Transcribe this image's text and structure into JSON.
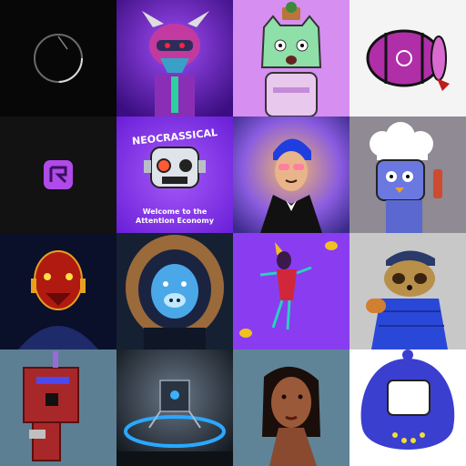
{
  "gallery": {
    "tiles": [
      {
        "name": "tile-ring",
        "icon": "ring-icon"
      },
      {
        "name": "tile-horned-monster",
        "icon": "monster-icon"
      },
      {
        "name": "tile-cat-plant",
        "icon": "cat-icon"
      },
      {
        "name": "tile-barrel",
        "icon": "barrel-icon"
      },
      {
        "name": "tile-r-logo",
        "icon": "r-logo-icon"
      },
      {
        "name": "tile-neocrassical-robot",
        "icon": "robot-icon"
      },
      {
        "name": "tile-blue-hair-tuxedo",
        "icon": "portrait-icon"
      },
      {
        "name": "tile-chef-robot",
        "icon": "chef-robot-icon"
      },
      {
        "name": "tile-red-mask",
        "icon": "mask-icon"
      },
      {
        "name": "tile-pig-parka",
        "icon": "pig-icon"
      },
      {
        "name": "tile-dancer-bees",
        "icon": "dancer-icon"
      },
      {
        "name": "tile-sloth-jacket",
        "icon": "sloth-icon"
      },
      {
        "name": "tile-circuit-board",
        "icon": "circuit-icon"
      },
      {
        "name": "tile-cube-portal",
        "icon": "cube-icon"
      },
      {
        "name": "tile-woman-portrait",
        "icon": "woman-icon"
      },
      {
        "name": "tile-tamagotchi",
        "icon": "tamagotchi-icon"
      }
    ],
    "neocrassical": {
      "title": "NEOCRASSICAL",
      "subtitle_line1": "Welcome to the",
      "subtitle_line2": "Attention Economy"
    }
  },
  "colors": {
    "purple_bright": "#8a3cf0",
    "lilac": "#d68ef0",
    "blue_deep": "#3a3fd0",
    "slate": "#5d7f93"
  }
}
